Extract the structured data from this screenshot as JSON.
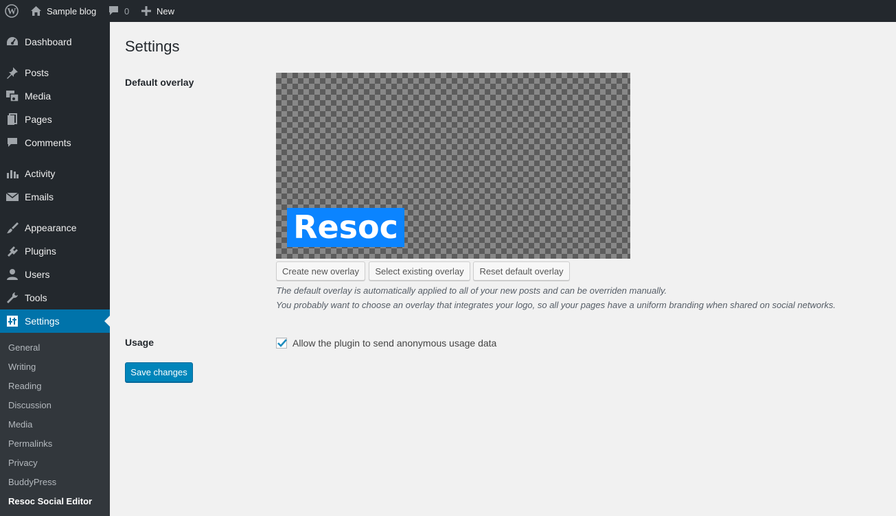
{
  "adminbar": {
    "site_name": "Sample blog",
    "comments_count": "0",
    "new_label": "New"
  },
  "sidebar": {
    "items": [
      {
        "label": "Dashboard",
        "icon": "dashboard-icon"
      },
      {
        "label": "Posts",
        "icon": "pin-icon"
      },
      {
        "label": "Media",
        "icon": "media-icon"
      },
      {
        "label": "Pages",
        "icon": "pages-icon"
      },
      {
        "label": "Comments",
        "icon": "comment-icon"
      },
      {
        "label": "Activity",
        "icon": "activity-icon"
      },
      {
        "label": "Emails",
        "icon": "email-icon"
      },
      {
        "label": "Appearance",
        "icon": "brush-icon"
      },
      {
        "label": "Plugins",
        "icon": "plug-icon"
      },
      {
        "label": "Users",
        "icon": "user-icon"
      },
      {
        "label": "Tools",
        "icon": "wrench-icon"
      },
      {
        "label": "Settings",
        "icon": "settings-icon",
        "current": true
      }
    ],
    "submenu": [
      "General",
      "Writing",
      "Reading",
      "Discussion",
      "Media",
      "Permalinks",
      "Privacy",
      "BuddyPress",
      "Resoc Social Editor"
    ],
    "current_submenu": "Resoc Social Editor"
  },
  "main": {
    "title": "Settings",
    "default_overlay": {
      "label": "Default overlay",
      "logo_text": "Resoc",
      "buttons": {
        "create": "Create new overlay",
        "select": "Select existing overlay",
        "reset": "Reset default overlay"
      },
      "description_1": "The default overlay is automatically applied to all of your new posts and can be overriden manually.",
      "description_2": "You probably want to choose an overlay that integrates your logo, so all your pages have a uniform branding when shared on social networks."
    },
    "usage": {
      "label": "Usage",
      "checkbox_label": "Allow the plugin to send anonymous usage data",
      "checked": true
    },
    "save_label": "Save changes"
  },
  "colors": {
    "adminbar": "#23282d",
    "sidebar": "#23282d",
    "submenu": "#32373c",
    "accent": "#0073aa",
    "primary_button": "#0085ba",
    "logo_bg": "#0b84ff"
  }
}
